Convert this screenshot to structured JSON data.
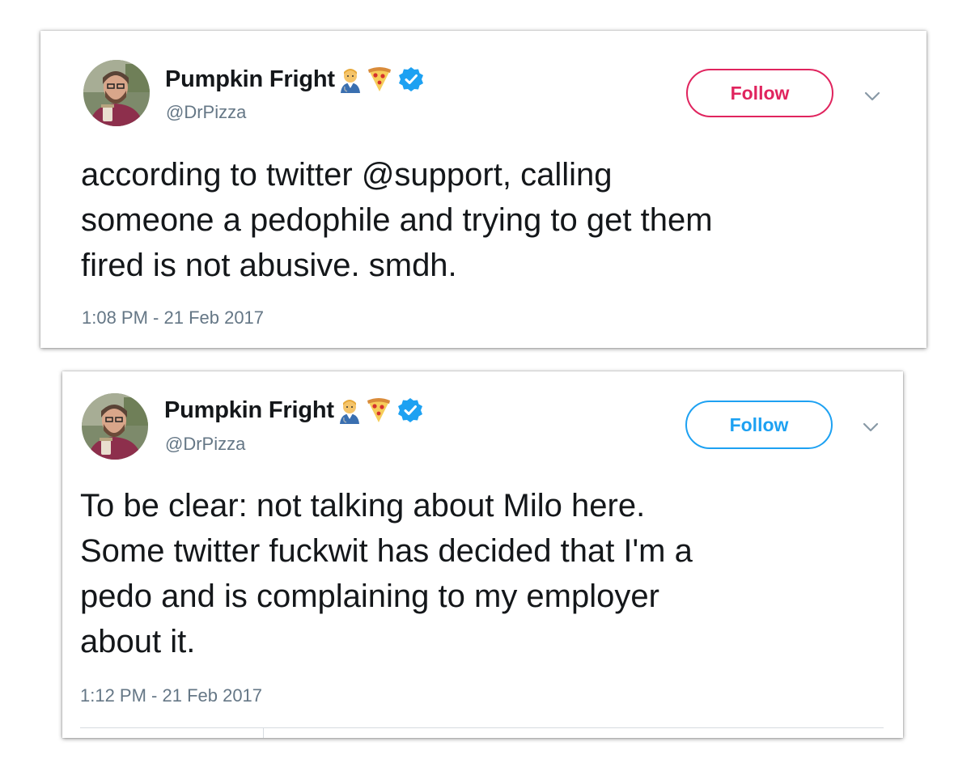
{
  "tweets": [
    {
      "display_name": "Pumpkin Fright",
      "handle": "@DrPizza",
      "follow_label": "Follow",
      "follow_color": "#e0245e",
      "text": "according to twitter @support, calling\nsomeone a pedophile and trying to get them\nfired is not abusive. smdh.",
      "timestamp": "1:08 PM - 21 Feb 2017",
      "icons": [
        "avatar",
        "man-health-worker-emoji-icon",
        "pizza-emoji-icon",
        "verified-badge-icon",
        "chevron-down-icon"
      ]
    },
    {
      "display_name": "Pumpkin Fright",
      "handle": "@DrPizza",
      "follow_label": "Follow",
      "follow_color": "#1da1f2",
      "text": "To be clear: not talking about Milo here.\nSome twitter fuckwit has decided that I'm a\npedo and is complaining to my employer\nabout it.",
      "timestamp": "1:12 PM - 21 Feb 2017",
      "icons": [
        "avatar",
        "man-health-worker-emoji-icon",
        "pizza-emoji-icon",
        "verified-badge-icon",
        "chevron-down-icon"
      ]
    }
  ],
  "colors": {
    "text_primary": "#14171a",
    "text_secondary": "#657786",
    "verified_blue": "#1da1f2"
  }
}
